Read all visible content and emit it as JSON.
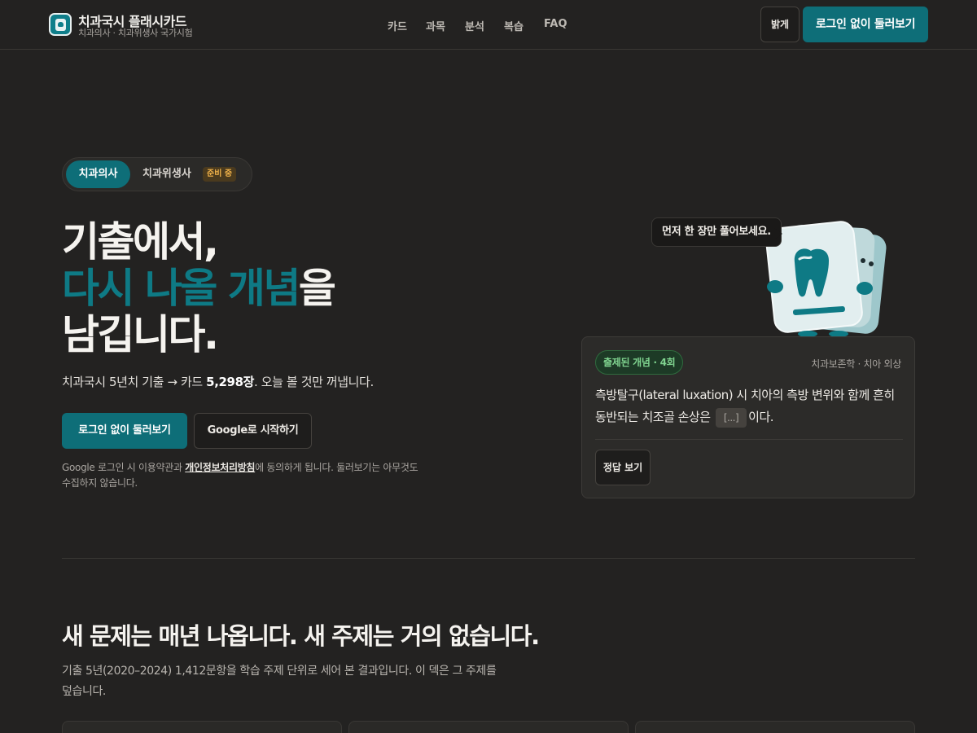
{
  "header": {
    "brand_title": "치과국시 플래시카드",
    "brand_sub": "치과의사 · 치과위생사 국가시험",
    "nav": [
      "카드",
      "과목",
      "분석",
      "복습",
      "FAQ"
    ],
    "theme_toggle": "밝게",
    "cta": "로그인 없이 둘러보기",
    "logo_icon": "tooth-card-icon"
  },
  "segment": {
    "active": "치과의사",
    "inactive": "치과위생사",
    "badge": "준비 중"
  },
  "hero": {
    "line1": "기출에서,",
    "line2_accent": "다시 나올 개념",
    "line2_rest": "을",
    "line3": "남깁니다.",
    "desc_prefix": "치과국시 5년치 기출 → 카드 ",
    "desc_count": "5,298장",
    "desc_suffix": ". 오늘 볼 것만 꺼냅니다.",
    "btn_primary": "로그인 없이 둘러보기",
    "btn_google": "Google로 시작하기",
    "consent_prefix": "Google 로그인 시 이용약관과 ",
    "consent_link": "개인정보처리방침",
    "consent_suffix": "에 동의하게 됩니다. 둘러보기는 아무것도 수집하지 않습니다."
  },
  "mascot": {
    "bubble": "먼저 한 장만 풀어보세요.",
    "icon": "tooth-card-mascot-icon"
  },
  "card": {
    "badge": "출제된 개념 · 4회",
    "subject": "치과보존학 · 치아 외상",
    "question_prefix": "측방탈구(lateral luxation) 시 치아의 측방 변위와 함께 흔히 동반되는 치조골 손상은",
    "blank": "[...]",
    "question_suffix": "이다.",
    "answer_button": "정답 보기"
  },
  "section": {
    "title": "새 문제는 매년 나옵니다. 새 주제는 거의 없습니다.",
    "desc": "기출 5년(2020–2024) 1,412문항을 학습 주제 단위로 세어 본 결과입니다. 이 덱은 그 주제를 덮습니다."
  },
  "colors": {
    "background": "#232221",
    "accent": "#0E6E78",
    "accent_text": "#0E7A85",
    "badge_green": "#7FD38F",
    "badge_orange": "#F0B24A"
  }
}
